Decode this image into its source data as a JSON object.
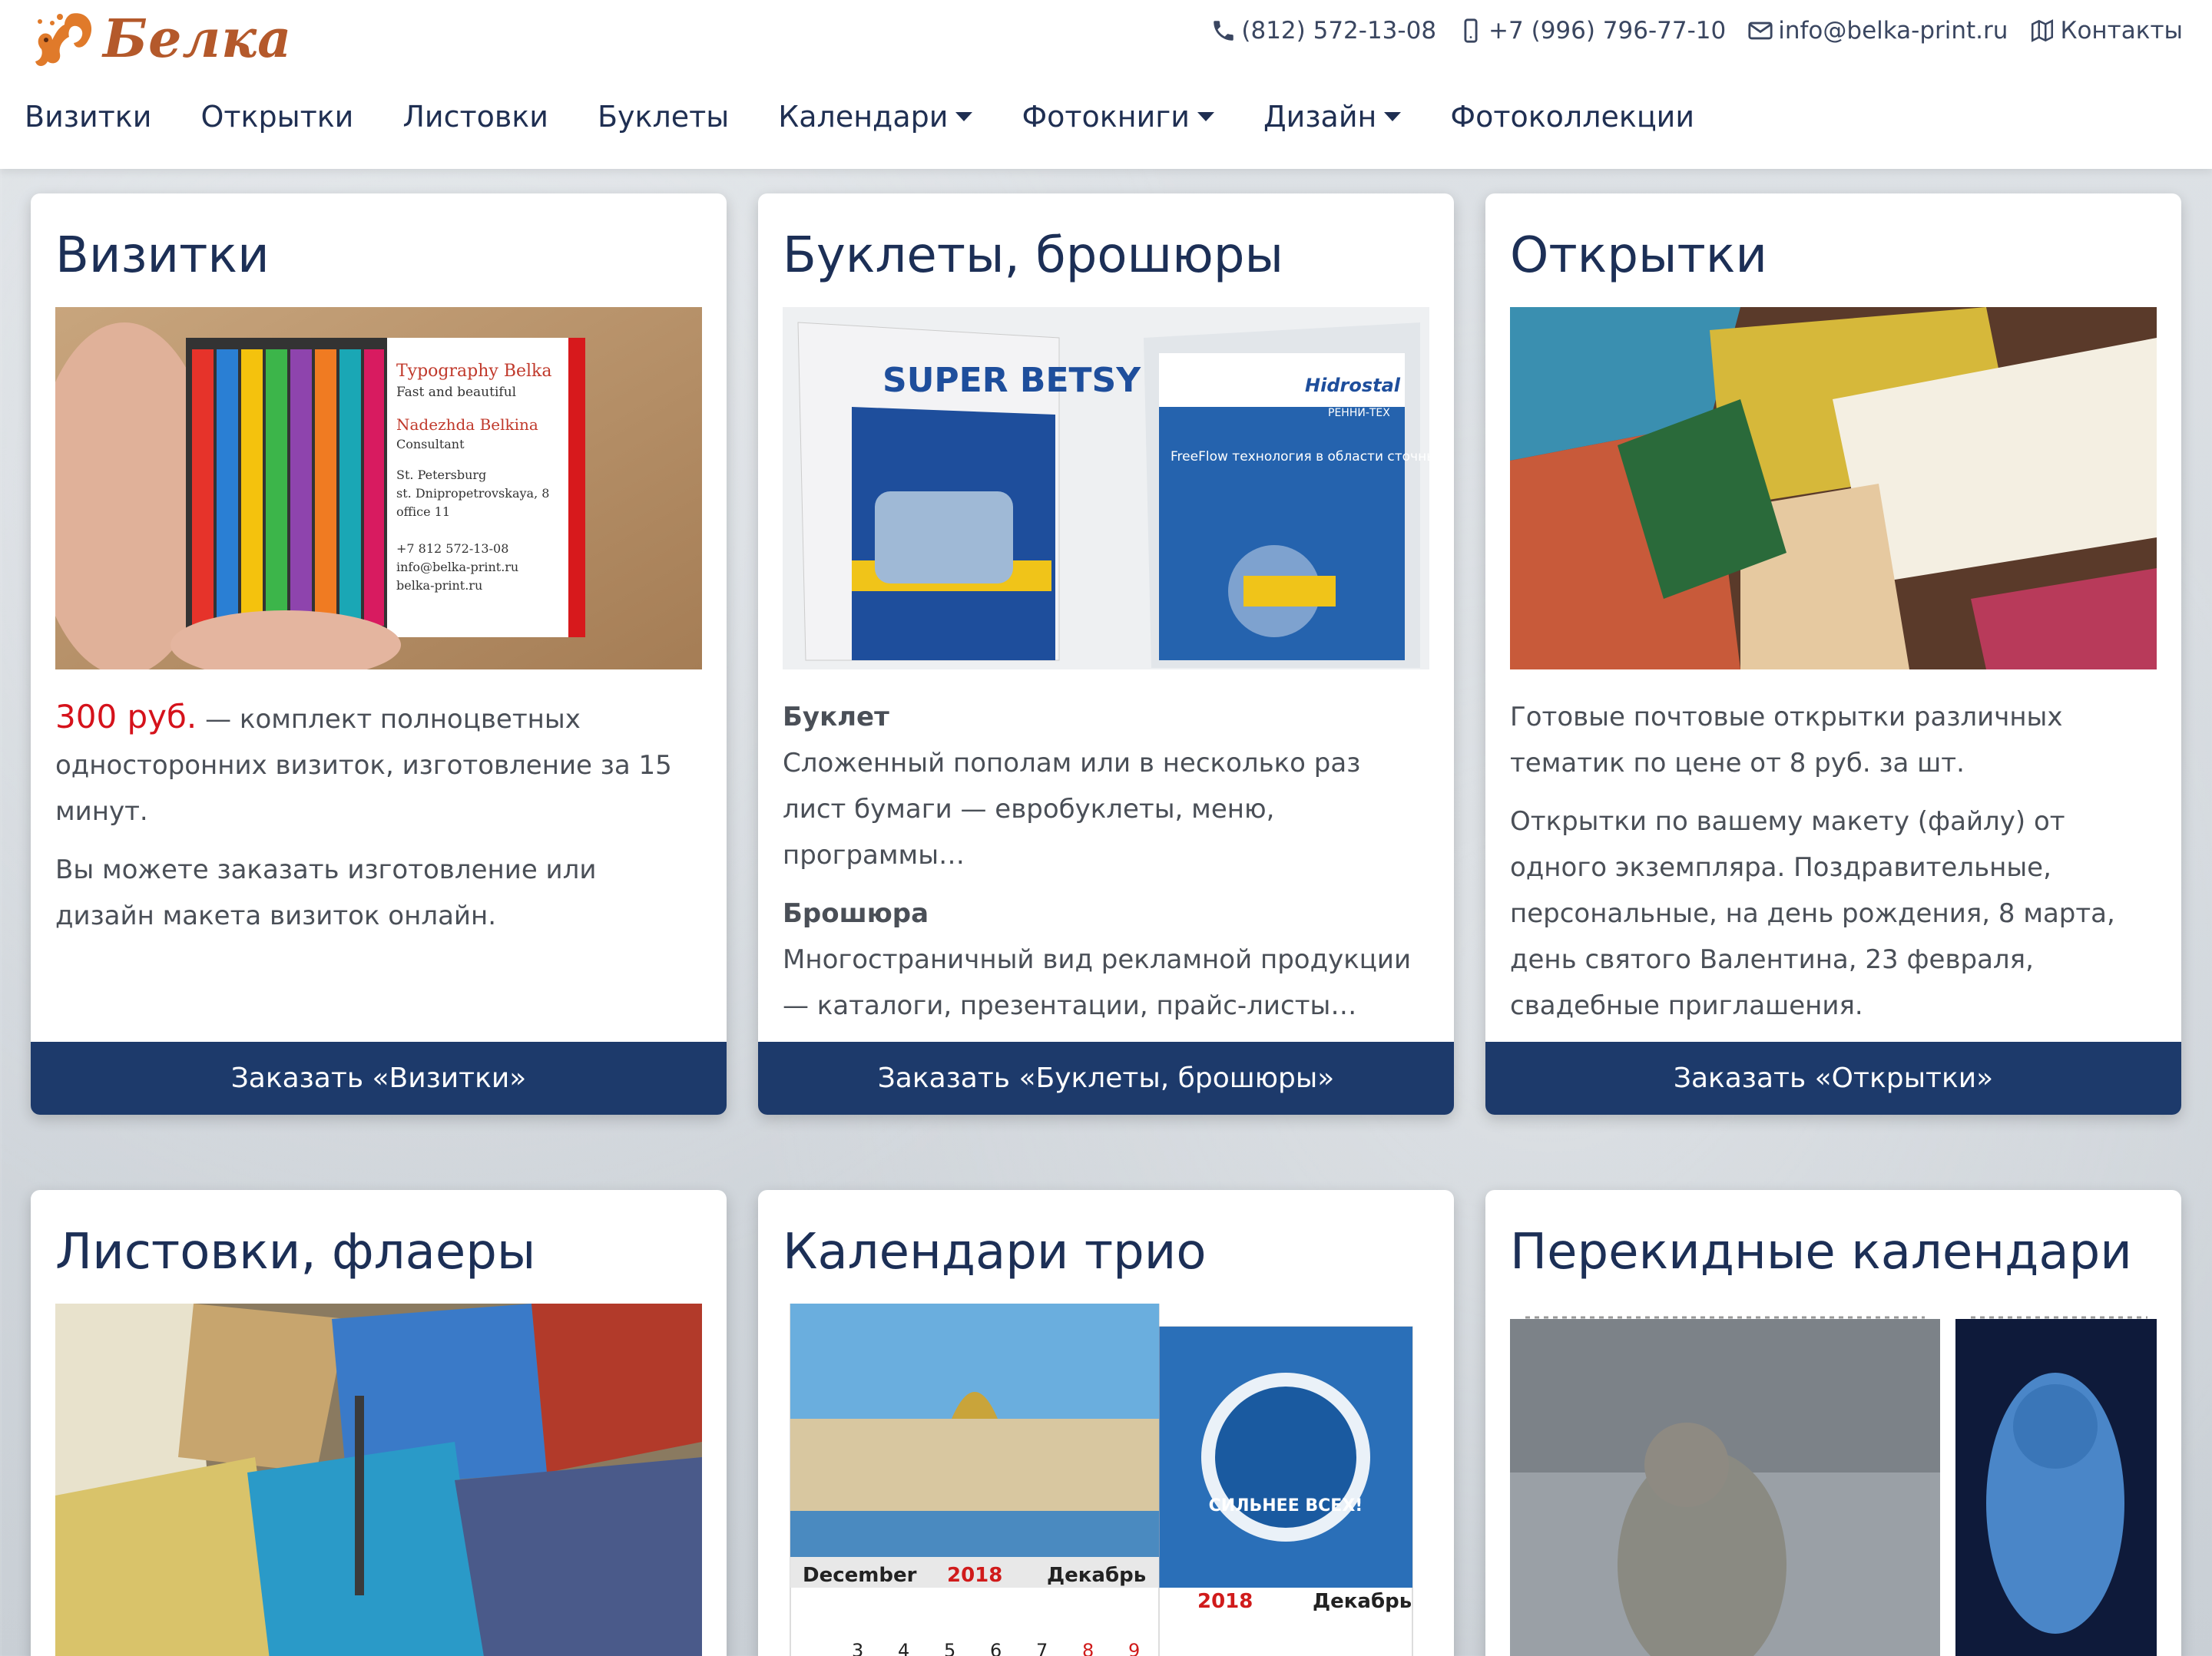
{
  "brand": {
    "name": "Белка",
    "color": "#b4592b"
  },
  "contacts": {
    "phone": "(812) 572-13-08",
    "mobile": "+7 (996) 796-77-10",
    "email": "info@belka-print.ru",
    "contacts_link": "Контакты"
  },
  "nav": [
    {
      "label": "Визитки"
    },
    {
      "label": "Открытки"
    },
    {
      "label": "Листовки"
    },
    {
      "label": "Буклеты"
    },
    {
      "label": "Календари",
      "dropdown": true
    },
    {
      "label": "Фотокниги",
      "dropdown": true
    },
    {
      "label": "Дизайн",
      "dropdown": true
    },
    {
      "label": "Фотоколлекции"
    }
  ],
  "cards": {
    "vizitki": {
      "title": "Визитки",
      "price": "300 руб.",
      "price_text": " — комплект полноцветных односторонних визиток, изготовление за 15 минут.",
      "text2": "Вы можете заказать изготовление или дизайн макета визиток онлайн.",
      "button": "Заказать «Визитки»",
      "card_text": {
        "line1": "Typography Belka",
        "line2": "Fast and beautiful",
        "line3": "Nadezhda Belkina",
        "line4": "Consultant",
        "line5": "St. Petersburg",
        "line6": "st. Dnipropetrovskaya, 8",
        "line7": "office 11",
        "line8": "+7 812 572-13-08",
        "line9": "info@belka-print.ru",
        "line10": "belka-print.ru"
      }
    },
    "buklety": {
      "title": "Буклеты, брошюры",
      "sub1": "Буклет",
      "text1": "Сложенный пополам или в несколько раз лист бумаги — евробуклеты, меню, программы…",
      "sub2": "Брошюра",
      "text2": "Многостраничный вид рекламной продукции — каталоги, презентации, прайс-листы…",
      "button": "Заказать «Буклеты, брошюры»",
      "img_left": "SUPER BETSY",
      "img_right_brand": "Hidrostal",
      "img_right_text": "FreeFlow технология в области сточных вод",
      "img_company": "РЕННИ-ТЕХ"
    },
    "otkrytki": {
      "title": "Открытки",
      "text1": "Готовые почтовые открытки различных тематик по цене от 8 руб. за шт.",
      "text2": "Открытки по вашему макету (файлу) от одного экземпляра.  Поздравительные, персональные, на день рождения, 8 марта, день святого Валентина, 23 февраля, свадебные приглашения.",
      "button": "Заказать «Открытки»"
    },
    "listovki": {
      "title": "Листовки, флаеры"
    },
    "kalendari_trio": {
      "title": "Календари трио",
      "month_en": "December",
      "year": "2018",
      "month_ru": "Декабрь",
      "badge": "СИЛЬНЕЕ ВСЕХ!",
      "days": [
        "3",
        "4",
        "5",
        "6",
        "7",
        "8",
        "9"
      ]
    },
    "perekidnye": {
      "title": "Перекидные календари"
    }
  }
}
